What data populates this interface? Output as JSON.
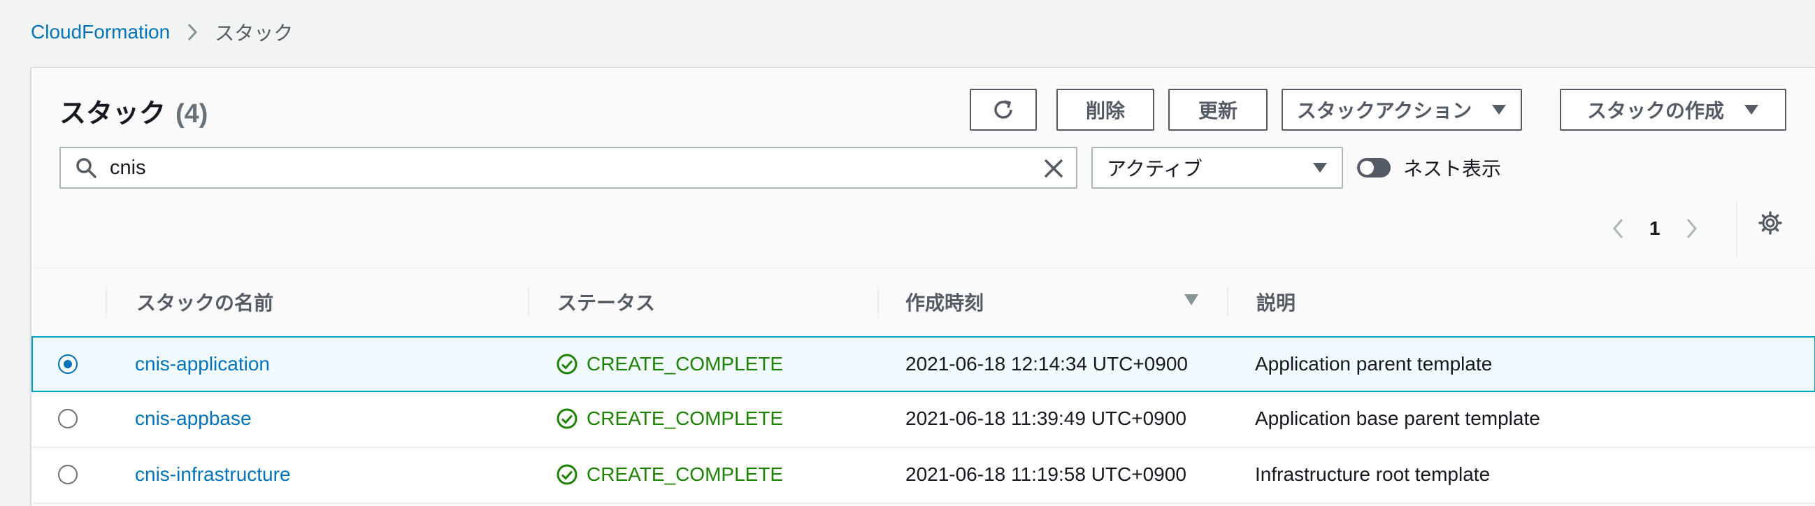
{
  "breadcrumb": {
    "root": "CloudFormation",
    "current": "スタック"
  },
  "panel": {
    "title": "スタック",
    "count": "(4)"
  },
  "toolbar": {
    "delete_label": "削除",
    "update_label": "更新",
    "stack_actions_label": "スタックアクション",
    "create_stack_label": "スタックの作成"
  },
  "filter": {
    "search_value": "cnis",
    "status_filter": "アクティブ",
    "nested_toggle_label": "ネスト表示"
  },
  "pagination": {
    "current_page": "1"
  },
  "table": {
    "columns": [
      "スタックの名前",
      "ステータス",
      "作成時刻",
      "説明"
    ],
    "rows": [
      {
        "name": "cnis-application",
        "status": "CREATE_COMPLETE",
        "created": "2021-06-18 12:14:34 UTC+0900",
        "description": "Application parent template",
        "selected": true
      },
      {
        "name": "cnis-appbase",
        "status": "CREATE_COMPLETE",
        "created": "2021-06-18 11:39:49 UTC+0900",
        "description": "Application base parent template",
        "selected": false
      },
      {
        "name": "cnis-infrastructure",
        "status": "CREATE_COMPLETE",
        "created": "2021-06-18 11:19:58 UTC+0900",
        "description": "Infrastructure root template",
        "selected": false
      }
    ]
  },
  "colors": {
    "link": "#0073bb",
    "success": "#1d8102",
    "selected_border": "#00a1c9",
    "selected_bg": "#f1faff"
  },
  "icons": [
    "chevron-right-icon",
    "refresh-icon",
    "caret-down-icon",
    "search-icon",
    "clear-icon",
    "toggle",
    "chevron-left-icon",
    "gear-icon",
    "sort-descending-icon",
    "success-check-icon"
  ]
}
